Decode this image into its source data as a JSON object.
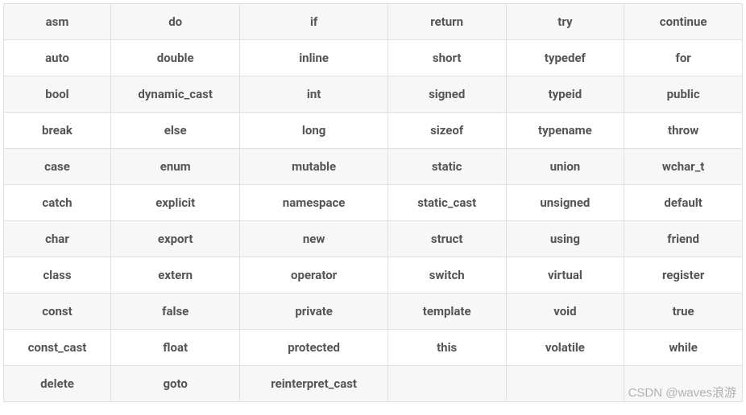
{
  "table": {
    "rows": [
      [
        "asm",
        "do",
        "if",
        "return",
        "try",
        "continue"
      ],
      [
        "auto",
        "double",
        "inline",
        "short",
        "typedef",
        "for"
      ],
      [
        "bool",
        "dynamic_cast",
        "int",
        "signed",
        "typeid",
        "public"
      ],
      [
        "break",
        "else",
        "long",
        "sizeof",
        "typename",
        "throw"
      ],
      [
        "case",
        "enum",
        "mutable",
        "static",
        "union",
        "wchar_t"
      ],
      [
        "catch",
        "explicit",
        "namespace",
        "static_cast",
        "unsigned",
        "default"
      ],
      [
        "char",
        "export",
        "new",
        "struct",
        "using",
        "friend"
      ],
      [
        "class",
        "extern",
        "operator",
        "switch",
        "virtual",
        "register"
      ],
      [
        "const",
        "false",
        "private",
        "template",
        "void",
        "true"
      ],
      [
        "const_cast",
        "float",
        "protected",
        "this",
        "volatile",
        "while"
      ],
      [
        "delete",
        "goto",
        "reinterpret_cast",
        "",
        "",
        ""
      ]
    ]
  },
  "watermark": "CSDN @waves浪游"
}
